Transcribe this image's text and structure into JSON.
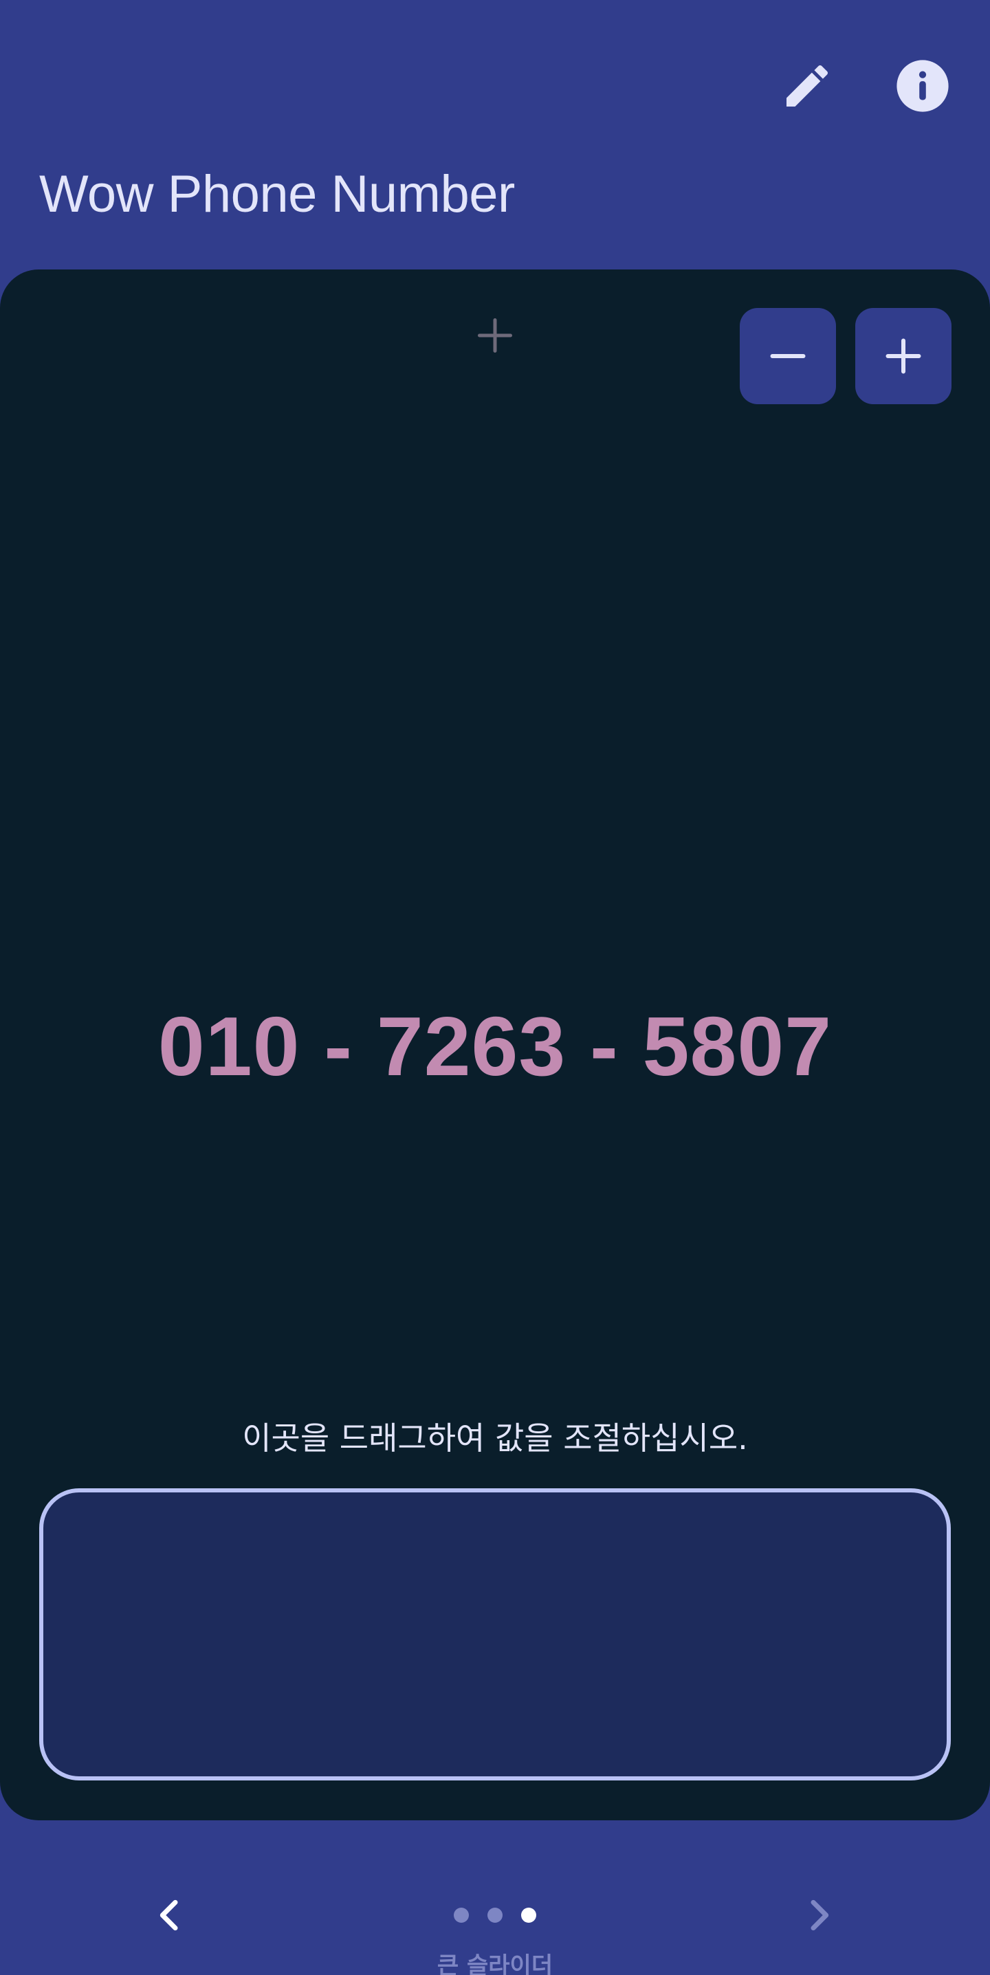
{
  "app": {
    "title": "Wow Phone Number"
  },
  "toolbar": {
    "edit_icon": "pencil-icon",
    "info_icon": "info-icon"
  },
  "card": {
    "add_hint_icon": "plus-icon",
    "decrement_icon": "minus-icon",
    "increment_icon": "plus-icon",
    "phone_number": "010 - 7263 - 5807",
    "drag_hint": "이곳을 드래그하여 값을 조절하십시오."
  },
  "bottom_nav": {
    "prev_icon": "chevron-left-icon",
    "next_icon": "chevron-right-icon",
    "page_count": 3,
    "active_page": 3,
    "page_label": "큰 슬라이더"
  },
  "colors": {
    "primary": "#313D8C",
    "card_background": "#0A1E2B",
    "number_text": "#C28BB1",
    "on_primary": "#E3E5FA",
    "drag_area_fill": "#1D2B5C",
    "drag_area_border": "#B9C2F5",
    "inactive_dot": "#7E86C4"
  }
}
